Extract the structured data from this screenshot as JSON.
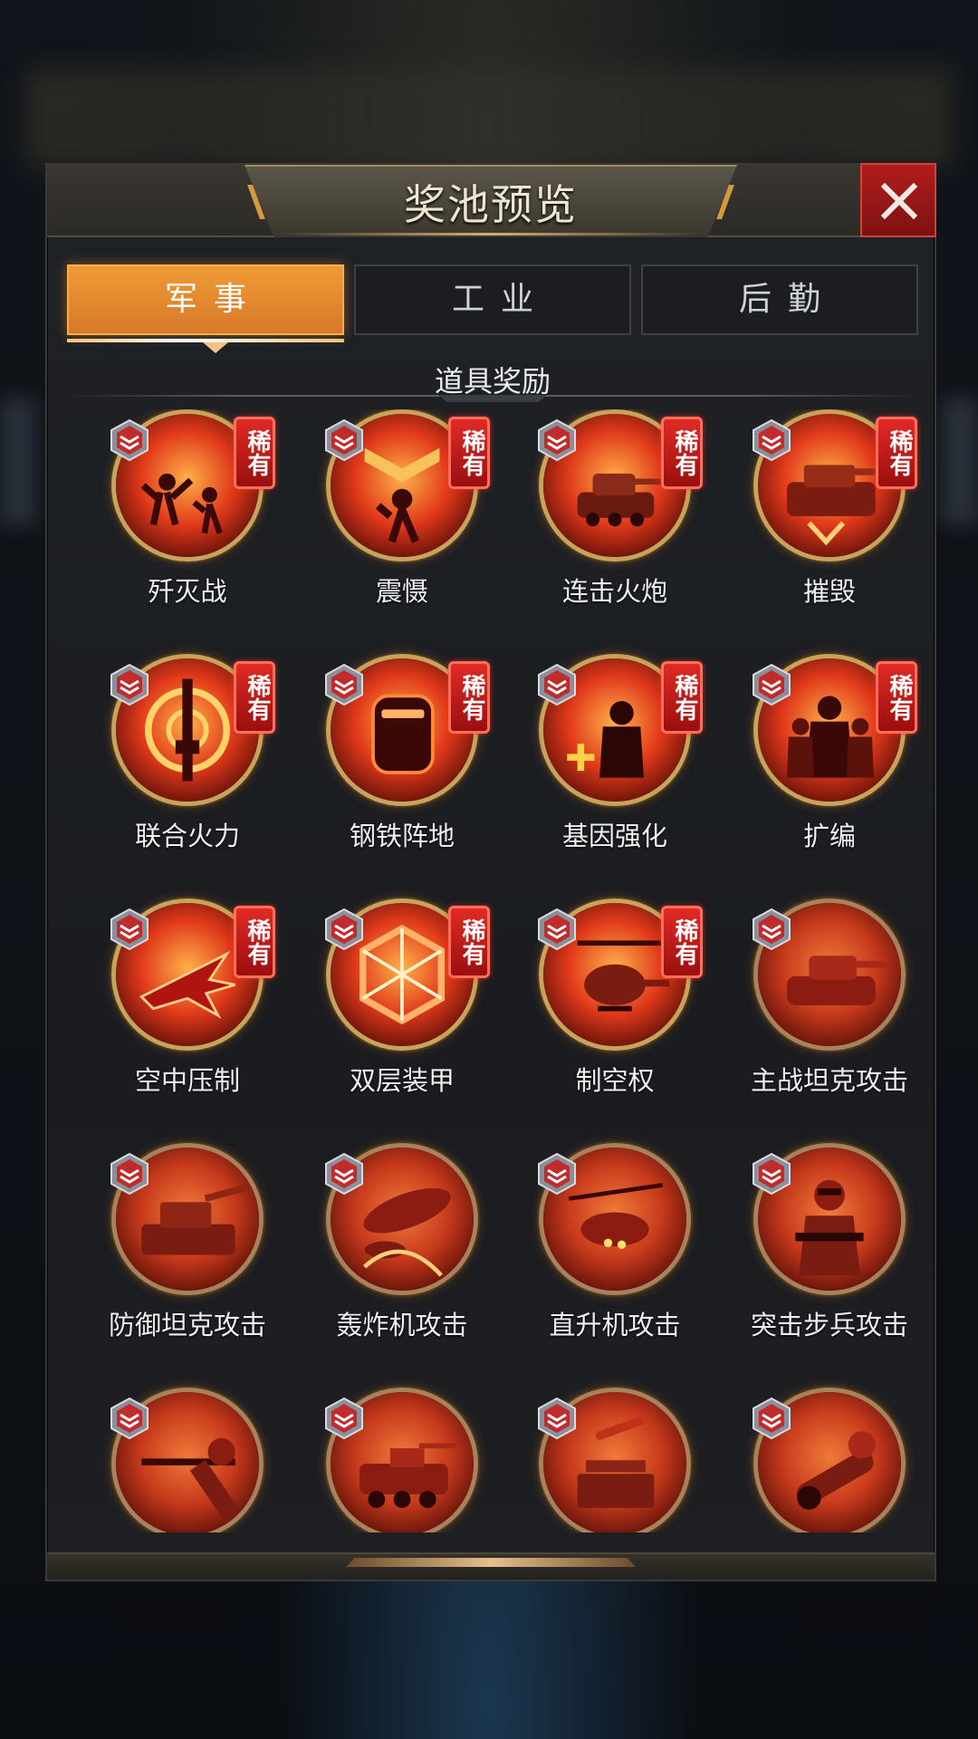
{
  "dialog": {
    "title": "奖池预览"
  },
  "tabs": [
    {
      "label": "军事",
      "active": true
    },
    {
      "label": "工业",
      "active": false
    },
    {
      "label": "后勤",
      "active": false
    }
  ],
  "section": {
    "title": "道具奖励"
  },
  "rare_badge": "稀有",
  "colors": {
    "accent": "#e5862f",
    "close": "#a8191a",
    "rare": "#d8231e",
    "icon_ring": "#c7a35b"
  },
  "items": [
    {
      "name": "歼灭战",
      "rare": true,
      "icon": "soldiers-fighting-icon"
    },
    {
      "name": "震慑",
      "rare": true,
      "icon": "chevron-soldier-icon"
    },
    {
      "name": "连击火炮",
      "rare": true,
      "icon": "tank-icon"
    },
    {
      "name": "摧毁",
      "rare": true,
      "icon": "heavy-tank-icon"
    },
    {
      "name": "联合火力",
      "rare": true,
      "icon": "rifle-target-icon"
    },
    {
      "name": "钢铁阵地",
      "rare": true,
      "icon": "riot-shield-icon"
    },
    {
      "name": "基因强化",
      "rare": true,
      "icon": "soldier-plus-icon"
    },
    {
      "name": "扩编",
      "rare": true,
      "icon": "troops-icon"
    },
    {
      "name": "空中压制",
      "rare": true,
      "icon": "jet-icon"
    },
    {
      "name": "双层装甲",
      "rare": true,
      "icon": "hex-armor-icon"
    },
    {
      "name": "制空权",
      "rare": true,
      "icon": "helicopter-icon"
    },
    {
      "name": "主战坦克攻击",
      "rare": false,
      "icon": "main-battle-tank-icon"
    },
    {
      "name": "防御坦克攻击",
      "rare": false,
      "icon": "defense-tank-icon"
    },
    {
      "name": "轰炸机攻击",
      "rare": false,
      "icon": "bomber-icon"
    },
    {
      "name": "直升机攻击",
      "rare": false,
      "icon": "attack-helicopter-icon"
    },
    {
      "name": "突击步兵攻击",
      "rare": false,
      "icon": "assault-infantry-icon"
    },
    {
      "name": "",
      "rare": false,
      "icon": "sniper-icon"
    },
    {
      "name": "",
      "rare": false,
      "icon": "armored-vehicle-icon"
    },
    {
      "name": "",
      "rare": false,
      "icon": "missile-launcher-icon"
    },
    {
      "name": "",
      "rare": false,
      "icon": "artillery-cannon-icon"
    }
  ]
}
